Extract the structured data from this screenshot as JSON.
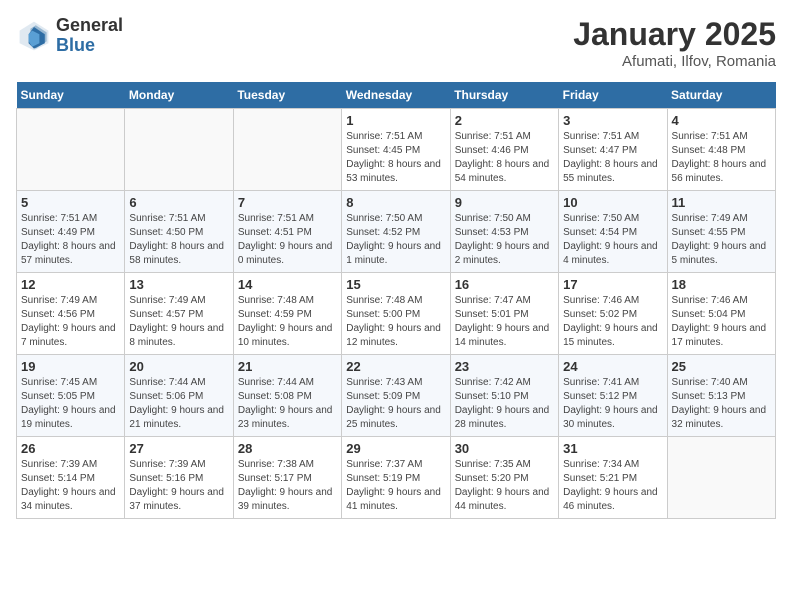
{
  "logo": {
    "general": "General",
    "blue": "Blue"
  },
  "header": {
    "month": "January 2025",
    "location": "Afumati, Ilfov, Romania"
  },
  "weekdays": [
    "Sunday",
    "Monday",
    "Tuesday",
    "Wednesday",
    "Thursday",
    "Friday",
    "Saturday"
  ],
  "weeks": [
    [
      {
        "day": "",
        "info": ""
      },
      {
        "day": "",
        "info": ""
      },
      {
        "day": "",
        "info": ""
      },
      {
        "day": "1",
        "info": "Sunrise: 7:51 AM\nSunset: 4:45 PM\nDaylight: 8 hours and 53 minutes."
      },
      {
        "day": "2",
        "info": "Sunrise: 7:51 AM\nSunset: 4:46 PM\nDaylight: 8 hours and 54 minutes."
      },
      {
        "day": "3",
        "info": "Sunrise: 7:51 AM\nSunset: 4:47 PM\nDaylight: 8 hours and 55 minutes."
      },
      {
        "day": "4",
        "info": "Sunrise: 7:51 AM\nSunset: 4:48 PM\nDaylight: 8 hours and 56 minutes."
      }
    ],
    [
      {
        "day": "5",
        "info": "Sunrise: 7:51 AM\nSunset: 4:49 PM\nDaylight: 8 hours and 57 minutes."
      },
      {
        "day": "6",
        "info": "Sunrise: 7:51 AM\nSunset: 4:50 PM\nDaylight: 8 hours and 58 minutes."
      },
      {
        "day": "7",
        "info": "Sunrise: 7:51 AM\nSunset: 4:51 PM\nDaylight: 9 hours and 0 minutes."
      },
      {
        "day": "8",
        "info": "Sunrise: 7:50 AM\nSunset: 4:52 PM\nDaylight: 9 hours and 1 minute."
      },
      {
        "day": "9",
        "info": "Sunrise: 7:50 AM\nSunset: 4:53 PM\nDaylight: 9 hours and 2 minutes."
      },
      {
        "day": "10",
        "info": "Sunrise: 7:50 AM\nSunset: 4:54 PM\nDaylight: 9 hours and 4 minutes."
      },
      {
        "day": "11",
        "info": "Sunrise: 7:49 AM\nSunset: 4:55 PM\nDaylight: 9 hours and 5 minutes."
      }
    ],
    [
      {
        "day": "12",
        "info": "Sunrise: 7:49 AM\nSunset: 4:56 PM\nDaylight: 9 hours and 7 minutes."
      },
      {
        "day": "13",
        "info": "Sunrise: 7:49 AM\nSunset: 4:57 PM\nDaylight: 9 hours and 8 minutes."
      },
      {
        "day": "14",
        "info": "Sunrise: 7:48 AM\nSunset: 4:59 PM\nDaylight: 9 hours and 10 minutes."
      },
      {
        "day": "15",
        "info": "Sunrise: 7:48 AM\nSunset: 5:00 PM\nDaylight: 9 hours and 12 minutes."
      },
      {
        "day": "16",
        "info": "Sunrise: 7:47 AM\nSunset: 5:01 PM\nDaylight: 9 hours and 14 minutes."
      },
      {
        "day": "17",
        "info": "Sunrise: 7:46 AM\nSunset: 5:02 PM\nDaylight: 9 hours and 15 minutes."
      },
      {
        "day": "18",
        "info": "Sunrise: 7:46 AM\nSunset: 5:04 PM\nDaylight: 9 hours and 17 minutes."
      }
    ],
    [
      {
        "day": "19",
        "info": "Sunrise: 7:45 AM\nSunset: 5:05 PM\nDaylight: 9 hours and 19 minutes."
      },
      {
        "day": "20",
        "info": "Sunrise: 7:44 AM\nSunset: 5:06 PM\nDaylight: 9 hours and 21 minutes."
      },
      {
        "day": "21",
        "info": "Sunrise: 7:44 AM\nSunset: 5:08 PM\nDaylight: 9 hours and 23 minutes."
      },
      {
        "day": "22",
        "info": "Sunrise: 7:43 AM\nSunset: 5:09 PM\nDaylight: 9 hours and 25 minutes."
      },
      {
        "day": "23",
        "info": "Sunrise: 7:42 AM\nSunset: 5:10 PM\nDaylight: 9 hours and 28 minutes."
      },
      {
        "day": "24",
        "info": "Sunrise: 7:41 AM\nSunset: 5:12 PM\nDaylight: 9 hours and 30 minutes."
      },
      {
        "day": "25",
        "info": "Sunrise: 7:40 AM\nSunset: 5:13 PM\nDaylight: 9 hours and 32 minutes."
      }
    ],
    [
      {
        "day": "26",
        "info": "Sunrise: 7:39 AM\nSunset: 5:14 PM\nDaylight: 9 hours and 34 minutes."
      },
      {
        "day": "27",
        "info": "Sunrise: 7:39 AM\nSunset: 5:16 PM\nDaylight: 9 hours and 37 minutes."
      },
      {
        "day": "28",
        "info": "Sunrise: 7:38 AM\nSunset: 5:17 PM\nDaylight: 9 hours and 39 minutes."
      },
      {
        "day": "29",
        "info": "Sunrise: 7:37 AM\nSunset: 5:19 PM\nDaylight: 9 hours and 41 minutes."
      },
      {
        "day": "30",
        "info": "Sunrise: 7:35 AM\nSunset: 5:20 PM\nDaylight: 9 hours and 44 minutes."
      },
      {
        "day": "31",
        "info": "Sunrise: 7:34 AM\nSunset: 5:21 PM\nDaylight: 9 hours and 46 minutes."
      },
      {
        "day": "",
        "info": ""
      }
    ]
  ]
}
